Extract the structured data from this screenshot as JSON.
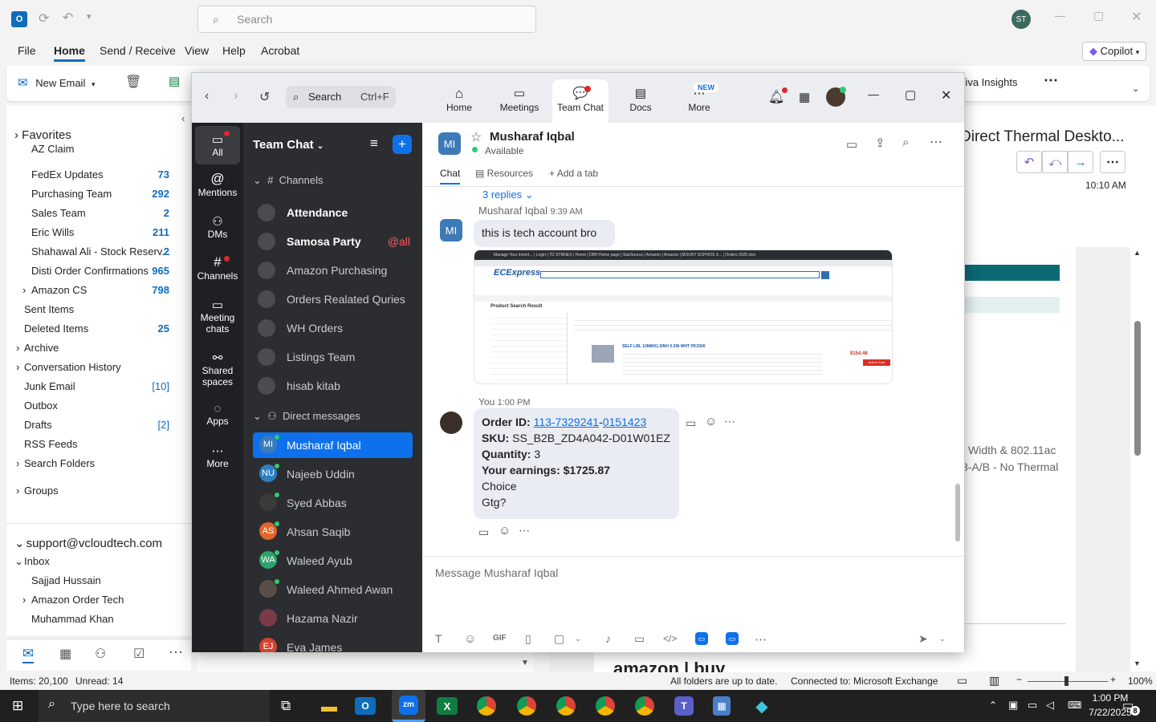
{
  "outlook": {
    "search_placeholder": "Search",
    "avatar": "ST",
    "menu": [
      "File",
      "Home",
      "Send / Receive",
      "View",
      "Help",
      "Acrobat"
    ],
    "copilot": "Copilot",
    "new_email": "New Email",
    "viva": "Viva Insights",
    "favorites": "Favorites",
    "folders": [
      {
        "label": "AZ Claim",
        "count": ""
      },
      {
        "label": "FedEx Updates",
        "count": "73"
      },
      {
        "label": "Purchasing Team",
        "count": "292"
      },
      {
        "label": "Sales Team",
        "count": "2"
      },
      {
        "label": "Eric Wills",
        "count": "211"
      },
      {
        "label": "Shahawal Ali - Stock Reserv...",
        "count": "2"
      },
      {
        "label": "Disti Order Confirmations",
        "count": "965"
      },
      {
        "label": "Amazon CS",
        "count": "798"
      },
      {
        "label": "Sent Items",
        "count": ""
      },
      {
        "label": "Deleted Items",
        "count": "25"
      },
      {
        "label": "Archive",
        "count": ""
      },
      {
        "label": "Conversation History",
        "count": ""
      },
      {
        "label": "Junk Email",
        "count": "[10]"
      },
      {
        "label": "Outbox",
        "count": ""
      },
      {
        "label": "Drafts",
        "count": "[2]"
      },
      {
        "label": "RSS Feeds",
        "count": ""
      },
      {
        "label": "Search Folders",
        "count": ""
      }
    ],
    "groups": "Groups",
    "account": "support@vcloudtech.com",
    "inbox": "Inbox",
    "inbox_items": [
      "Sajjad Hussain",
      "Amazon Order Tech",
      "Muhammad Khan"
    ],
    "reading_title": "Direct Thermal Deskto...",
    "reading_time": "10:10 AM",
    "reading_line1": "Width & 802.11ac",
    "reading_line2": "3-A/B - No Thermal",
    "reading_bottom": "amazon | buy",
    "status_items": "Items: 20,100",
    "status_unread": "Unread: 14",
    "status_sync": "All folders are up to date.",
    "status_conn": "Connected to: Microsoft Exchange",
    "zoom_level": "100%"
  },
  "zoom": {
    "search_label": "Search",
    "search_shortcut": "Ctrl+F",
    "tabs": [
      "Home",
      "Meetings",
      "Team Chat",
      "Docs",
      "More"
    ],
    "new_badge": "NEW",
    "rail": [
      "All",
      "Mentions",
      "DMs",
      "Channels",
      "Meeting chats",
      "Shared spaces",
      "Apps",
      "More"
    ],
    "list_title": "Team Chat",
    "channels_header": "Channels",
    "channels": [
      {
        "name": "Attendance",
        "bold": true,
        "badge": ""
      },
      {
        "name": "Samosa Party",
        "bold": true,
        "badge": "@all"
      },
      {
        "name": "Amazon Purchasing",
        "bold": false,
        "badge": ""
      },
      {
        "name": "Orders Realated Quries",
        "bold": false,
        "badge": ""
      },
      {
        "name": "WH Orders",
        "bold": false,
        "badge": ""
      },
      {
        "name": "Listings Team",
        "bold": false,
        "badge": ""
      },
      {
        "name": "hisab kitab",
        "bold": false,
        "badge": ""
      }
    ],
    "dm_header": "Direct messages",
    "dms": [
      {
        "name": "Musharaf Iqbal",
        "initials": "MI",
        "color": "#3d7ab8"
      },
      {
        "name": "Najeeb Uddin",
        "initials": "NU",
        "color": "#2f7fc1"
      },
      {
        "name": "Syed Abbas",
        "initials": "",
        "color": "#3a3a3a"
      },
      {
        "name": "Ahsan Saqib",
        "initials": "AS",
        "color": "#e0662b"
      },
      {
        "name": "Waleed Ayub",
        "initials": "WA",
        "color": "#2ea36b"
      },
      {
        "name": "Waleed Ahmed Awan",
        "initials": "",
        "color": "#5a4e48"
      },
      {
        "name": "Hazama Nazir",
        "initials": "",
        "color": "#7a3b46"
      },
      {
        "name": "Eva James",
        "initials": "EJ",
        "color": "#d1452e"
      }
    ],
    "contact_initials": "MI",
    "contact_name": "Musharaf Iqbal",
    "contact_status": "Available",
    "chat_tabs": [
      "Chat",
      "Resources",
      "Add a tab"
    ],
    "replies": "3 replies",
    "msg1_sender": "Musharaf Iqbal",
    "msg1_time": "9:39 AM",
    "msg1_text": "this is tech account bro",
    "msg2_sender": "You",
    "msg2_time": "1:00 PM",
    "order_label": "Order ID:",
    "order_part1": "113-7329241",
    "order_sep": "-",
    "order_part2": "0151423",
    "sku_label": "SKU:",
    "sku_value": "SS_B2B_ZD4A042-D01W01EZ",
    "qty_label": "Quantity:",
    "qty_value": "3",
    "earn_label": "Your earnings: $1725.87",
    "line_choice": "Choice",
    "line_gtg": "Gtg?",
    "composer_placeholder": "Message Musharaf Iqbal",
    "gif_label": "GIF",
    "screenshot": {
      "tabs": "Manage Your Invent... | Login | TD SYNNEX | Home | DBH Home page | StarSource | Amazon | Amazon | MOUNT SOPHOS X... | Orders 2025.xlsx",
      "logo": "ECExpress",
      "result_title": "Product Search Result",
      "item_title": "SELF LBL 10MMX1.5INH 0.3IN WHT PK2500",
      "price": "$154.48",
      "cart": "Add to Cart"
    }
  },
  "taskbar": {
    "search_placeholder": "Type here to search",
    "time": "1:00 PM",
    "date": "7/22/2025",
    "notif": "8"
  },
  "colors": {
    "zoom_blue": "#0e71eb",
    "outlook_blue": "#0f6cbd",
    "rail_bg": "#1f2023",
    "list_bg": "#2b2d31",
    "selected": "#0e71eb"
  }
}
